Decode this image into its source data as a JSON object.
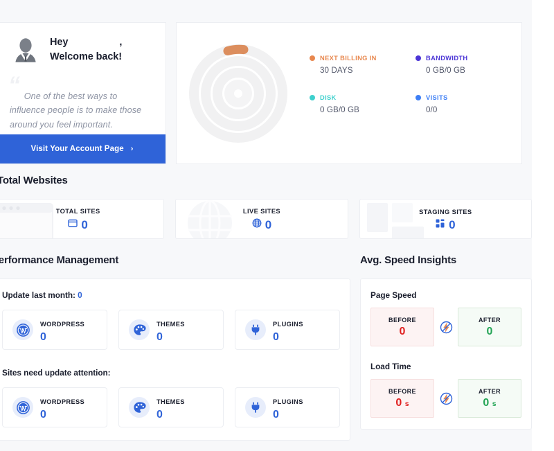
{
  "welcome": {
    "greeting_prefix": "Hey",
    "greeting_name": "",
    "greeting_comma": ",",
    "welcome_line": "Welcome back!",
    "quote": "One of the best ways to influence people is to make those around you feel important.",
    "account_button": "Visit Your Account Page",
    "account_button_chevron": "›",
    "avatar_icon": "user-avatar-icon"
  },
  "stats": {
    "donut_icon": "multi-ring-donut-chart",
    "legend": [
      {
        "label": "NEXT BILLING IN",
        "value": "30 DAYS",
        "color": "#e8874e"
      },
      {
        "label": "BANDWIDTH",
        "value": "0 GB/0 GB",
        "color": "#4b35d6"
      },
      {
        "label": "DISK",
        "value": "0 GB/0 GB",
        "color": "#3ed0cd"
      },
      {
        "label": "VISITS",
        "value": "0/0",
        "color": "#3d7ef5"
      }
    ]
  },
  "total_websites": {
    "heading": "Total Websites",
    "cards": [
      {
        "label": "TOTAL SITES",
        "value": "0",
        "icon": "browser-window-icon",
        "watermark": "browser-window-watermark"
      },
      {
        "label": "LIVE SITES",
        "value": "0",
        "icon": "globe-icon",
        "watermark": "globe-watermark"
      },
      {
        "label": "STAGING SITES",
        "value": "0",
        "icon": "dashboard-blocks-icon",
        "watermark": "layout-blocks-watermark"
      }
    ]
  },
  "performance": {
    "heading": "Performance Management",
    "update_last_month_label": "Update last month:",
    "update_last_month_count": "0",
    "attention_label": "Sites need update attention:",
    "update_cards_month": [
      {
        "label": "WORDPRESS",
        "value": "0",
        "icon": "wordpress-icon"
      },
      {
        "label": "THEMES",
        "value": "0",
        "icon": "palette-icon"
      },
      {
        "label": "PLUGINS",
        "value": "0",
        "icon": "plug-icon"
      }
    ],
    "update_cards_attention": [
      {
        "label": "WORDPRESS",
        "value": "0",
        "icon": "wordpress-icon"
      },
      {
        "label": "THEMES",
        "value": "0",
        "icon": "palette-icon"
      },
      {
        "label": "PLUGINS",
        "value": "0",
        "icon": "plug-icon"
      }
    ]
  },
  "speed": {
    "heading": "Avg. Speed Insights",
    "separator_icon": "lightning-bolt-icon",
    "groups": [
      {
        "title": "Page Speed",
        "before_label": "BEFORE",
        "before_value": "0",
        "before_unit": "",
        "after_label": "AFTER",
        "after_value": "0",
        "after_unit": ""
      },
      {
        "title": "Load Time",
        "before_label": "BEFORE",
        "before_value": "0",
        "before_unit": "s",
        "after_label": "AFTER",
        "after_value": "0",
        "after_unit": "s"
      }
    ]
  },
  "colors": {
    "accent_blue": "#2f63d8",
    "page_bg": "#f7f8fa",
    "card_bg": "#ffffff",
    "red": "#e02020",
    "green": "#23a455",
    "orange": "#e8874e"
  }
}
